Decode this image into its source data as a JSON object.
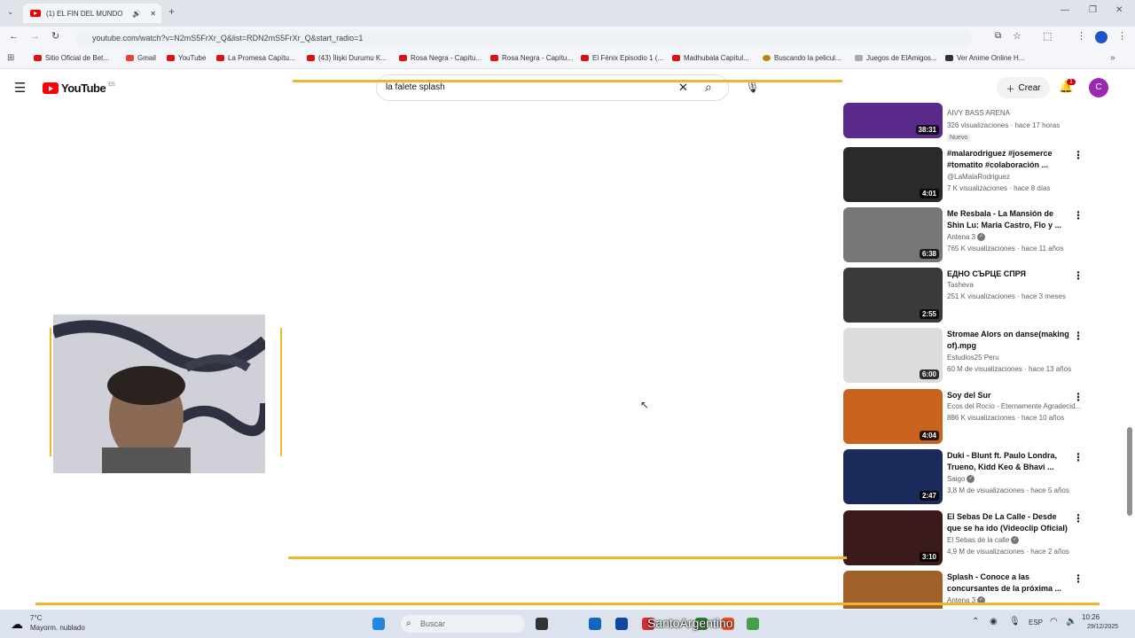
{
  "browser": {
    "tab_title": "(1) EL FIN DEL MUNDO",
    "new_tab": "+",
    "url": "youtube.com/watch?v=N2mS5FrXr_Q&list=RDN2mS5FrXr_Q&start_radio=1",
    "bookmarks": [
      "Sitio Oficial de Bet...",
      "Gmail",
      "YouTube",
      "La Promesa Capítu...",
      "(43) İlişki Durumu K...",
      "Rosa Negra - Capítu...",
      "Rosa Negra - Capítu...",
      "El Fénix Episodio 1 (...",
      "Madhubala Capítul...",
      "Buscando la pelicul...",
      "Juegos de ElAmigos...",
      "Ver Anime Online H..."
    ]
  },
  "youtube": {
    "logo_text": "YouTube",
    "logo_region": "ES",
    "search_value": "la falete splash",
    "create_label": "Crear",
    "notification_count": "1",
    "avatar_letter": "C"
  },
  "recommendations": [
    {
      "title": "",
      "channel": "AIVY BASS ARENA",
      "meta": "326 visualizaciones · hace 17 horas",
      "badge": "Nuevo",
      "duration": "38:31",
      "thumb_color": "#5a2a8a"
    },
    {
      "title": "#malarodriguez #josemerce #tomatito #colaboración ...",
      "channel": "@LaMalaRodriguez",
      "meta": "7 K visualizaciones · hace 8 días",
      "badge": "",
      "duration": "4:01",
      "thumb_color": "#2a2a2a"
    },
    {
      "title": "Me Resbala - La Mansión de Shin Lu: María Castro, Flo y ...",
      "channel": "Antena 3",
      "meta": "765 K visualizaciones · hace 11 años",
      "badge": "",
      "duration": "6:38",
      "thumb_color": "#777777"
    },
    {
      "title": "ЕДНО СЪРЦЕ СПРЯ",
      "channel": "Tasheva",
      "meta": "251 K visualizaciones · hace 3 meses",
      "badge": "",
      "duration": "2:55",
      "thumb_color": "#3a3a3a"
    },
    {
      "title": "Stromae   Alors on danse(making of).mpg",
      "channel": "Estudios25 Peru",
      "meta": "60 M de visualizaciones · hace 13 años",
      "badge": "",
      "duration": "6:00",
      "thumb_color": "#dcdcdc"
    },
    {
      "title": "Soy del Sur",
      "channel": "Ecos del Rocío - Eternamente Agradecid...",
      "meta": "886 K visualizaciones · hace 10 años",
      "badge": "",
      "duration": "4:04",
      "thumb_color": "#c8641e"
    },
    {
      "title": "Duki - Blunt ft. Paulo Londra, Trueno, Kidd Keo & Bhavi ...",
      "channel": "Saigo",
      "meta": "3,8 M de visualizaciones · hace 5 años",
      "badge": "",
      "duration": "2:47",
      "thumb_color": "#1a2a5a"
    },
    {
      "title": "El Sebas De La Calle - Desde que se ha ido (Videoclip Oficial)",
      "channel": "El Sebas de la calle",
      "meta": "4,9 M de visualizaciones · hace 2 años",
      "badge": "",
      "duration": "3:10",
      "thumb_color": "#3a1a1a"
    },
    {
      "title": "Splash - Conoce a las concursantes de la próxima ...",
      "channel": "Antena 3",
      "meta": "",
      "badge": "",
      "duration": "",
      "thumb_color": "#a0602a"
    }
  ],
  "taskbar": {
    "weather_temp": "7°C",
    "weather_desc": "Mayorm. nublado",
    "search_placeholder": "Buscar",
    "language": "ESP",
    "time": "10:26",
    "date": "29/12/2025",
    "overlay_name": "SantoArgentino"
  },
  "colors": {
    "accent_frame": "#f5b52b",
    "yt_red": "#ff0000",
    "avatar": "#9c27b0"
  }
}
